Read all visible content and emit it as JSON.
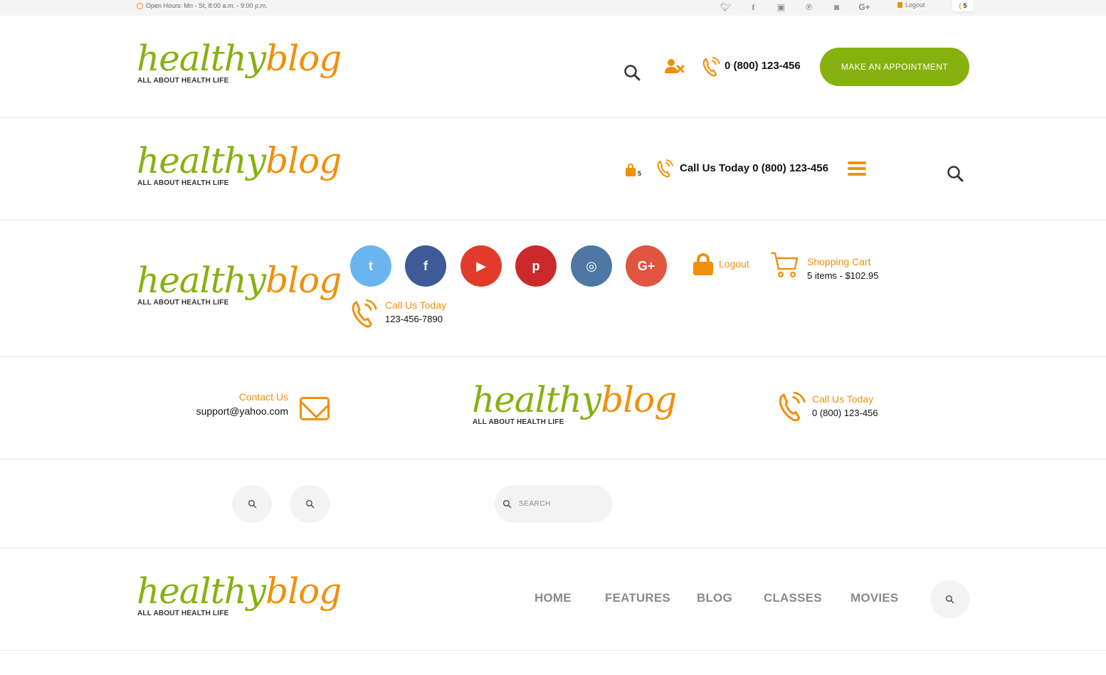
{
  "brand": {
    "logo_word_green": "healthy",
    "logo_word_orange": "blog",
    "tagline": "ALL ABOUT HEALTH LIFE",
    "green": "#86b10f",
    "orange": "#f0900a"
  },
  "topbar": {
    "hours": "Open Hours:  Mn - St, 8:00 a.m. - 9:00 p.m.",
    "social_icons": [
      "twitter-icon",
      "facebook-icon",
      "youtube-icon",
      "pinterest-icon",
      "instagram-icon",
      "google-plus-icon"
    ],
    "logout": "Logout",
    "cart_count": "5"
  },
  "header1": {
    "phone": "0 (800) 123-456",
    "appointment_button": "MAKE AN APPOINTMENT"
  },
  "header2": {
    "cart_count": "5",
    "call_text": "Call Us Today  0 (800) 123-456"
  },
  "header3": {
    "social": [
      {
        "name": "twitter",
        "glyph": "t",
        "color": "#6ab5ef"
      },
      {
        "name": "facebook",
        "glyph": "f",
        "color": "#3e5b98"
      },
      {
        "name": "youtube",
        "glyph": "▶",
        "color": "#e33b2b"
      },
      {
        "name": "pinterest",
        "glyph": "p",
        "color": "#cc2a2a"
      },
      {
        "name": "instagram",
        "glyph": "◎",
        "color": "#4d78a3"
      },
      {
        "name": "google-plus",
        "glyph": "G+",
        "color": "#df5540"
      }
    ],
    "logout": "Logout",
    "cart_title": "Shopping Cart",
    "cart_info": "5 items - $102.95",
    "call_title": "Call Us Today",
    "call_number": "123-456-7890"
  },
  "header4": {
    "contact_title": "Contact Us",
    "contact_email": "support@yahoo.com",
    "call_title": "Call Us Today",
    "call_number": "0 (800) 123-456"
  },
  "search_row": {
    "placeholder": "SEARCH"
  },
  "header6": {
    "nav": [
      "HOME",
      "FEATURES",
      "BLOG",
      "CLASSES",
      "MOVIES"
    ]
  }
}
